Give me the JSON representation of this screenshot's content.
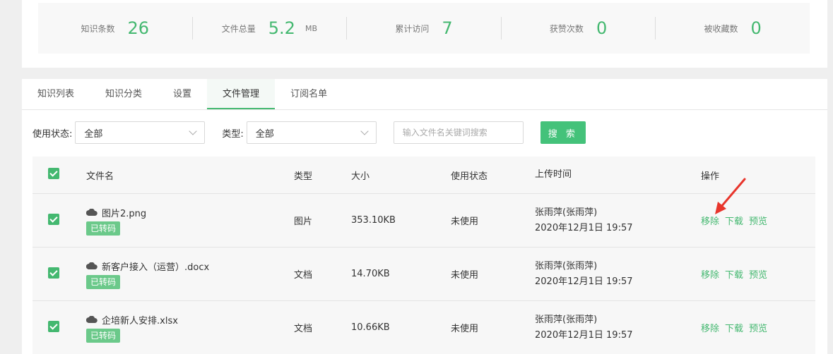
{
  "stats": [
    {
      "label": "知识条数",
      "value": "26",
      "unit": ""
    },
    {
      "label": "文件总量",
      "value": "5.2",
      "unit": "MB"
    },
    {
      "label": "累计访问",
      "value": "7",
      "unit": ""
    },
    {
      "label": "获赞次数",
      "value": "0",
      "unit": ""
    },
    {
      "label": "被收藏数",
      "value": "0",
      "unit": ""
    }
  ],
  "tabs": [
    "知识列表",
    "知识分类",
    "设置",
    "文件管理",
    "订阅名单"
  ],
  "active_tab": "文件管理",
  "filters": {
    "status_label": "使用状态:",
    "status_value": "全部",
    "type_label": "类型:",
    "type_value": "全部",
    "search_placeholder": "输入文件名关键词搜索",
    "search_button": "搜 索"
  },
  "table": {
    "headers": [
      "文件名",
      "类型",
      "大小",
      "使用状态",
      "上传时间",
      "操作"
    ],
    "rows": [
      {
        "name": "图片2.png",
        "badge": "已转码",
        "type": "图片",
        "size": "353.10KB",
        "status": "未使用",
        "uploader": "张雨萍(张雨萍)",
        "time": "2020年12月1日 19:57"
      },
      {
        "name": "新客户接入（运营）.docx",
        "badge": "已转码",
        "type": "文档",
        "size": "14.70KB",
        "status": "未使用",
        "uploader": "张雨萍(张雨萍)",
        "time": "2020年12月1日 19:57"
      },
      {
        "name": "企培新人安排.xlsx",
        "badge": "已转码",
        "type": "文档",
        "size": "10.66KB",
        "status": "未使用",
        "uploader": "张雨萍(张雨萍)",
        "time": "2020年12月1日 19:57"
      }
    ],
    "ops": [
      "移除",
      "下载",
      "预览"
    ]
  },
  "colors": {
    "accent": "#44b870",
    "annotation_arrow": "#e8352c"
  }
}
